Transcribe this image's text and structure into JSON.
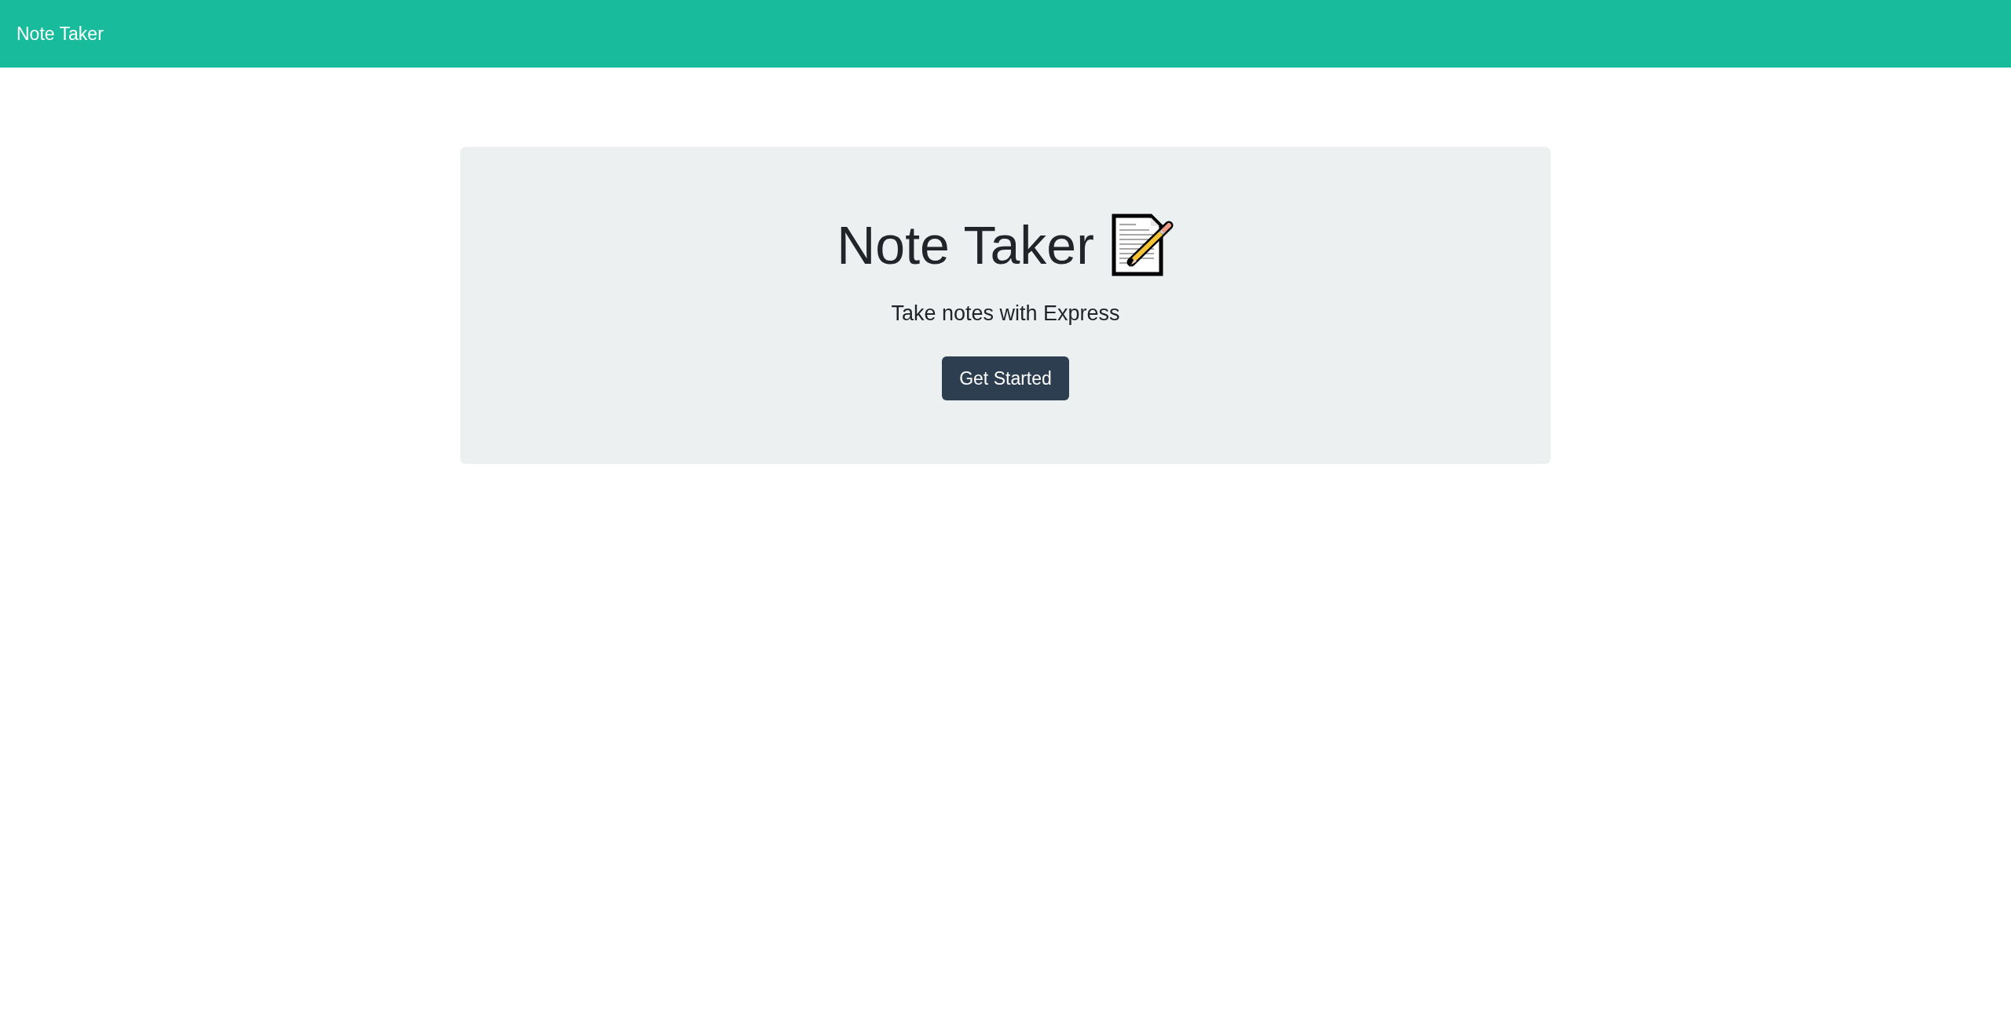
{
  "navbar": {
    "brand": "Note Taker"
  },
  "hero": {
    "title": "Note Taker",
    "subtitle": "Take notes with Express",
    "button": "Get Started"
  }
}
